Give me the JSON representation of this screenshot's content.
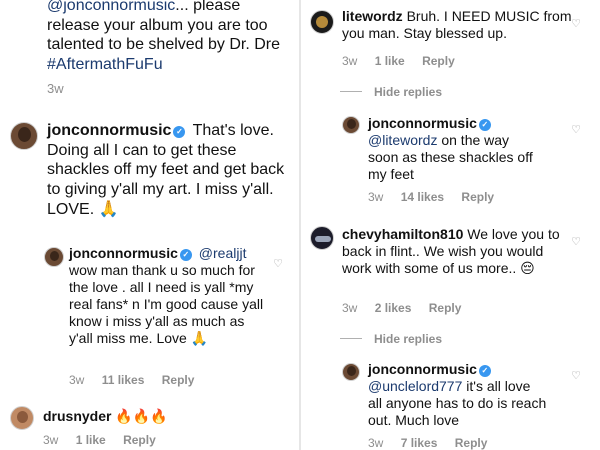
{
  "left": {
    "top_comment": {
      "text_line1_mention": "@jonconnormusic",
      "text_line1_rest": "... please",
      "text_rest": "release your album you are too talented to be shelved by Dr. Dre",
      "hashtag": "#AftermathFuFu",
      "time": "3w"
    },
    "reply_main": {
      "username": "jonconnormusic",
      "text": "That's love. Doing all I can to get these shackles off my feet and get back to giving y'all my art. I miss y'all. LOVE.",
      "emoji": "🙏",
      "time": "3w"
    },
    "reply_nested": {
      "username": "jonconnormusic",
      "mention": "@realjjt",
      "text": "wow man thank u so much for the love . all I need is yall *my real fans* n I'm good cause yall know i miss y'all as much as y'all miss me. Love",
      "emoji": "🙏",
      "time": "3w",
      "likes": "11 likes",
      "reply_label": "Reply"
    },
    "bottom_comment": {
      "username": "drusnyder",
      "emoji": "🔥🔥🔥",
      "time": "3w",
      "likes": "1 like",
      "reply_label": "Reply"
    }
  },
  "right": {
    "c1": {
      "username": "litewordz",
      "text": "Bruh. I NEED MUSIC from you man. Stay blessed up.",
      "time": "3w",
      "likes": "1 like",
      "reply_label": "Reply"
    },
    "hide_replies_1": "Hide replies",
    "c1_reply": {
      "username": "jonconnormusic",
      "mention": "@litewordz",
      "text": "on the way soon as these shackles off my feet",
      "time": "3w",
      "likes": "14 likes",
      "reply_label": "Reply"
    },
    "c2": {
      "username": "chevyhamilton810",
      "text": "We love you to back in flint.. We wish you would work with some of us more..",
      "emoji": "😔",
      "time": "3w",
      "likes": "2 likes",
      "reply_label": "Reply"
    },
    "hide_replies_2": "Hide replies",
    "c2_reply": {
      "username": "jonconnormusic",
      "mention": "@unclelord777",
      "text": "it's all love all anyone has to do is reach out. Much love",
      "time": "3w",
      "likes": "7 likes",
      "reply_label": "Reply"
    }
  },
  "icons": {
    "verified": "verified-badge-icon",
    "like": "heart-icon"
  },
  "colors": {
    "mention": "#1b3a6e",
    "meta": "#8e8e8e",
    "verified": "#3897f0"
  }
}
